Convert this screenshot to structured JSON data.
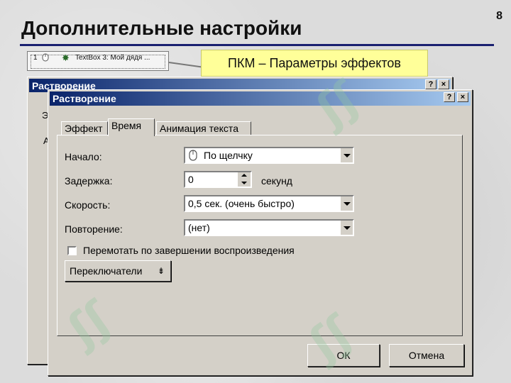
{
  "slide": {
    "title": "Дополнительные настройки",
    "number": "8"
  },
  "anim_item": {
    "index": "1",
    "text": "TextBox 3: Мой дядя ..."
  },
  "callout": {
    "text": "ПКМ – Параметры эффектов"
  },
  "back_dialog": {
    "title": "Растворение",
    "help_label": "?",
    "close_label": "×",
    "tab_edge_fragment": "Э",
    "content_edge_fragment": "А"
  },
  "dialog": {
    "title": "Растворение",
    "help_label": "?",
    "close_label": "×",
    "tabs": [
      {
        "label": "Эффект",
        "active": false
      },
      {
        "label": "Время",
        "active": true
      },
      {
        "label": "Анимация текста",
        "active": false
      }
    ],
    "start": {
      "label": "Начало:",
      "value": "По щелчку"
    },
    "delay": {
      "label": "Задержка:",
      "value": "0",
      "unit": "секунд"
    },
    "speed": {
      "label": "Скорость:",
      "value": "0,5 сек. (очень быстро)"
    },
    "repeat": {
      "label": "Повторение:",
      "value": "(нет)"
    },
    "rewind": {
      "label": "Перемотать по завершении воспроизведения",
      "checked": false
    },
    "triggers_button": "Переключатели",
    "ok_button": "ОК",
    "cancel_button": "Отмена"
  },
  "colors": {
    "titlebar_start": "#0a246a",
    "titlebar_end": "#a6caf0",
    "callout_bg": "#ffff99",
    "dialog_face": "#d4d0c8"
  }
}
